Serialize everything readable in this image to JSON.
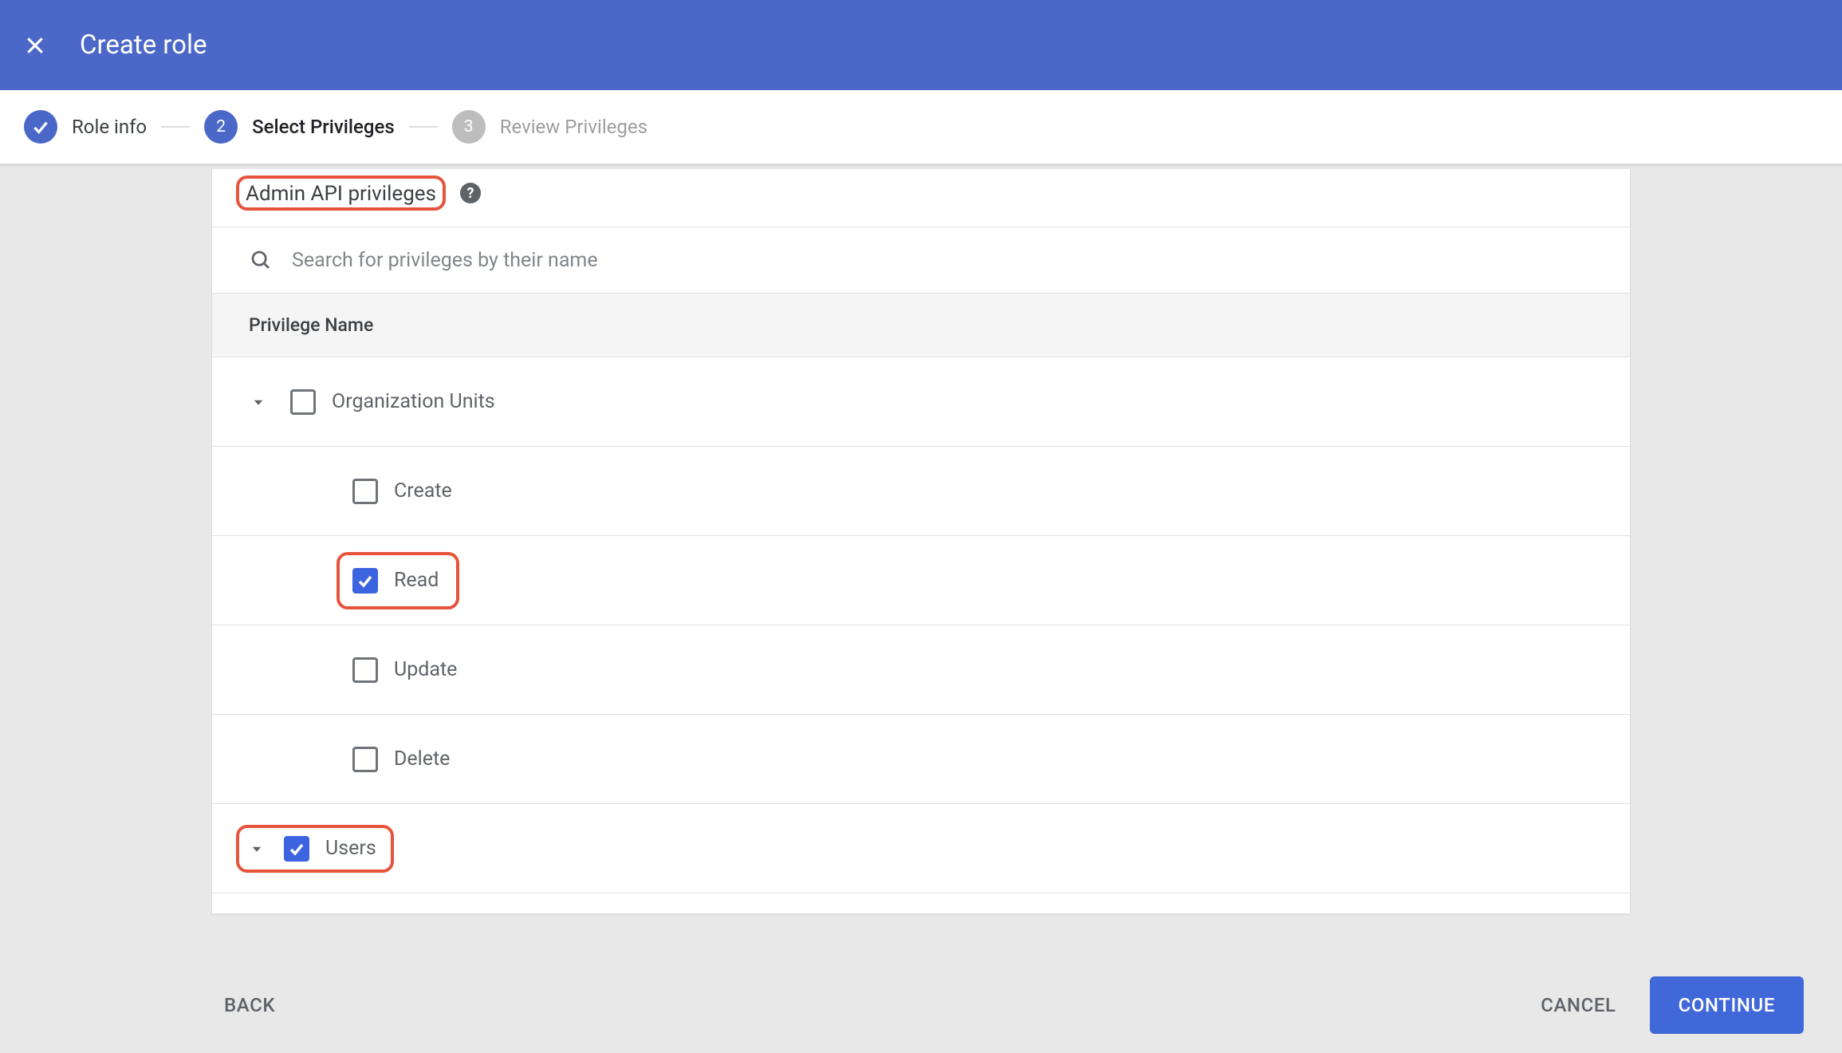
{
  "header": {
    "title": "Create role"
  },
  "stepper": {
    "steps": [
      {
        "label": "Role info",
        "num": "1",
        "state": "done"
      },
      {
        "label": "Select Privileges",
        "num": "2",
        "state": "active"
      },
      {
        "label": "Review Privileges",
        "num": "3",
        "state": "pending"
      }
    ]
  },
  "panel": {
    "title": "Admin API privileges",
    "search_placeholder": "Search for privileges by their name",
    "column_header": "Privilege Name"
  },
  "privileges": {
    "org_units": {
      "label": "Organization Units",
      "checked": false,
      "children": {
        "create": {
          "label": "Create",
          "checked": false
        },
        "read": {
          "label": "Read",
          "checked": true
        },
        "update": {
          "label": "Update",
          "checked": false
        },
        "delete": {
          "label": "Delete",
          "checked": false
        }
      }
    },
    "users": {
      "label": "Users",
      "checked": true
    }
  },
  "footer": {
    "back": "BACK",
    "cancel": "CANCEL",
    "continue": "CONTINUE"
  }
}
